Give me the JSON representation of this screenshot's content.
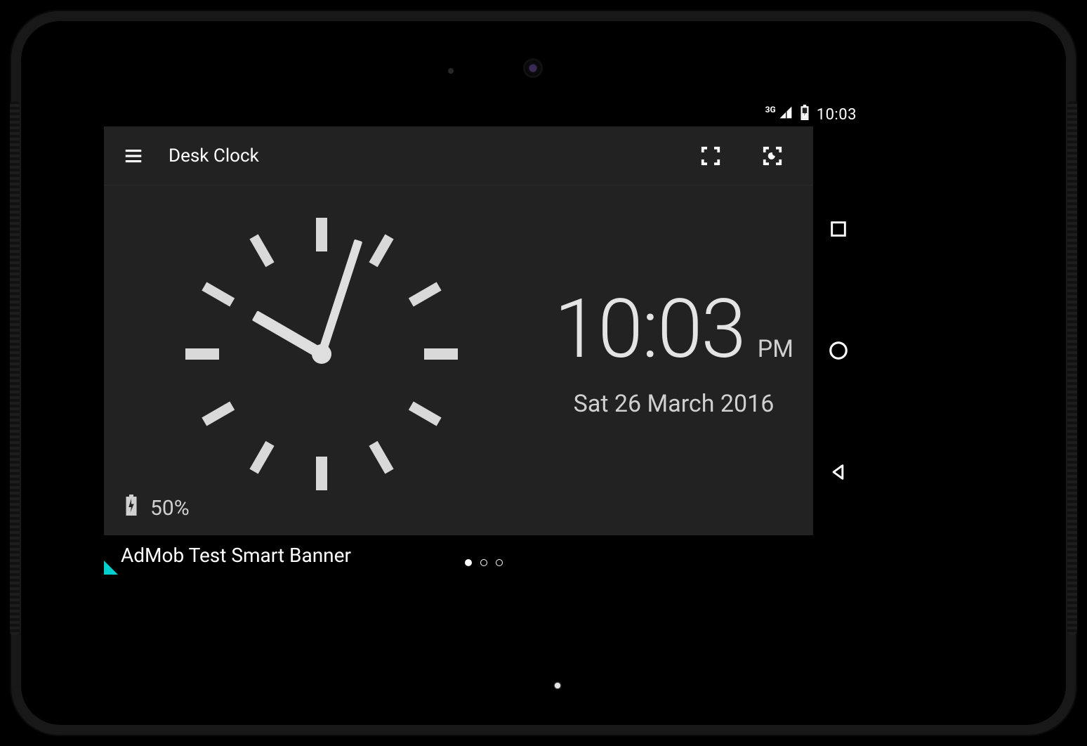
{
  "statusbar": {
    "network": "3G",
    "time": "10:03"
  },
  "toolbar": {
    "title": "Desk Clock"
  },
  "clock": {
    "digital_time": "10:03",
    "ampm": "PM",
    "date": "Sat 26 March 2016",
    "hour_angle": 300,
    "minute_angle": 18
  },
  "battery": {
    "percent": "50%"
  },
  "ad": {
    "text": "AdMob Test Smart Banner"
  },
  "icons": {
    "menu": "menu-icon",
    "fullscreen": "fullscreen-icon",
    "night": "night-mode-icon",
    "settings": "gear-icon",
    "signal": "signal-icon",
    "batt_sm": "battery-charging-icon",
    "back": "back-icon",
    "home": "home-icon",
    "recent": "recent-icon"
  }
}
